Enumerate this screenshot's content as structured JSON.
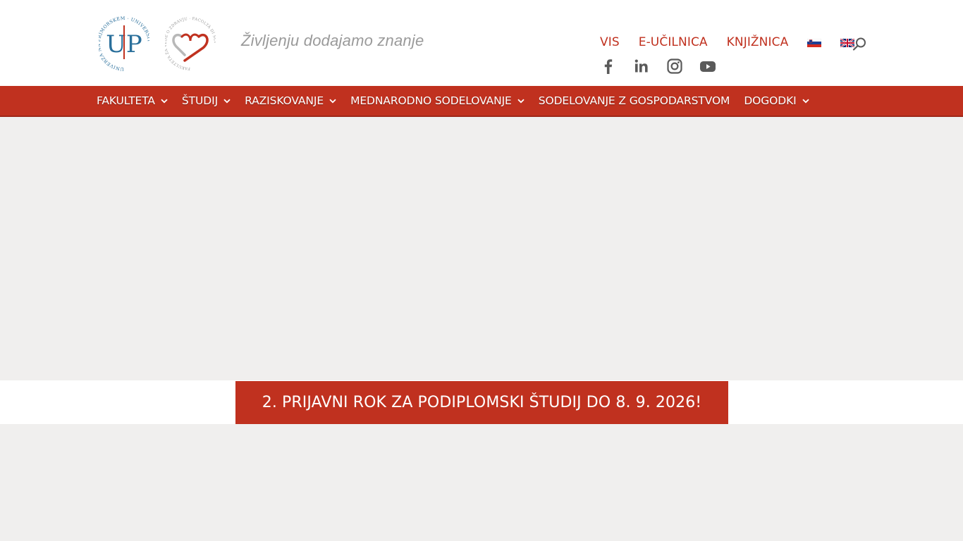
{
  "header": {
    "tagline": "Življenju dodajamo znanje",
    "logo_up_letters": "UP",
    "logo_up_ring": "UNIVERZA NA PRIMORSKEM · UNIVERSITÀ DEL LITORALE",
    "logo_fvz_ring": "FAKULTETA ZA VEDE O ZDRAVJU · FACOLTÀ DI SCIENZE DELLA SALUTE"
  },
  "toplinks": [
    {
      "label": "VIS"
    },
    {
      "label": "E-UČILNICA"
    },
    {
      "label": "KNJIŽNICA"
    }
  ],
  "languages": [
    {
      "name": "slovenian-flag-icon"
    },
    {
      "name": "english-flag-icon"
    }
  ],
  "social": [
    {
      "name": "facebook-icon"
    },
    {
      "name": "linkedin-icon"
    },
    {
      "name": "instagram-icon"
    },
    {
      "name": "youtube-icon"
    }
  ],
  "nav": [
    {
      "label": "FAKULTETA",
      "has_submenu": true
    },
    {
      "label": "ŠTUDIJ",
      "has_submenu": true
    },
    {
      "label": "RAZISKOVANJE",
      "has_submenu": true
    },
    {
      "label": "MEDNARODNO SODELOVANJE",
      "has_submenu": true
    },
    {
      "label": "SODELOVANJE Z GOSPODARSTVOM",
      "has_submenu": false
    },
    {
      "label": "DOGODKI",
      "has_submenu": true
    }
  ],
  "banner": {
    "label": "2. PRIJAVNI ROK ZA PODIPLOMSKI ŠTUDIJ DO 8. 9. 2026!"
  },
  "colors": {
    "brand_red": "#c0311f",
    "logo_blue": "#2a6f9b",
    "muted_text": "#9a9a9a",
    "page_bg": "#f0efee",
    "icon_gray": "#5a5a5a"
  }
}
